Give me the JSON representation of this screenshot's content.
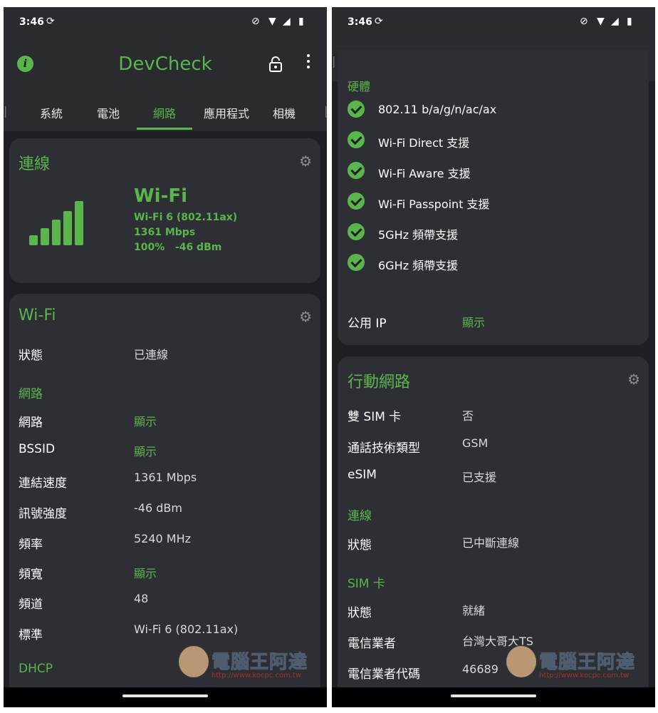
{
  "status": {
    "time": "3:46"
  },
  "app": {
    "title": "DevCheck"
  },
  "tabs": [
    "系統",
    "電池",
    "網路",
    "應用程式",
    "相機"
  ],
  "colors": {
    "accent": "#5ab54d",
    "background": "#1e1f22",
    "card": "#2e2f34"
  },
  "left": {
    "connection": {
      "title": "連線",
      "type": "Wi-Fi",
      "standard": "Wi-Fi 6 (802.11ax)",
      "speed": "1361 Mbps",
      "signal_percent": "100%",
      "signal_dbm": "-46 dBm",
      "signal_bars": 5
    },
    "wifi": {
      "title": "Wi-Fi",
      "status_label": "狀態",
      "status_value": "已連線",
      "section_network": "網路",
      "rows": [
        {
          "label": "網路",
          "value": "顯示",
          "link": true
        },
        {
          "label": "BSSID",
          "value": "顯示",
          "link": true
        },
        {
          "label": "連結速度",
          "value": "1361 Mbps",
          "link": false
        },
        {
          "label": "訊號強度",
          "value": "-46 dBm",
          "link": false
        },
        {
          "label": "頻率",
          "value": "5240 MHz",
          "link": false
        },
        {
          "label": "頻寬",
          "value": "顯示",
          "link": true
        },
        {
          "label": "頻道",
          "value": "48",
          "link": false
        },
        {
          "label": "標準",
          "value": "Wi-Fi 6 (802.11ax)",
          "link": false
        }
      ],
      "section_dhcp": "DHCP"
    }
  },
  "right": {
    "hardware": {
      "section": "硬體",
      "features": [
        "802.11 b/a/g/n/ac/ax",
        "Wi-Fi Direct 支援",
        "Wi-Fi Aware 支援",
        "Wi-Fi Passpoint 支援",
        "5GHz 頻帶支援",
        "6GHz 頻帶支援"
      ],
      "public_ip_label": "公用 IP",
      "public_ip_value": "顯示"
    },
    "mobile": {
      "title": "行動網路",
      "rows": [
        {
          "label": "雙 SIM 卡",
          "value": "否"
        },
        {
          "label": "通話技術類型",
          "value": "GSM"
        },
        {
          "label": "eSIM",
          "value": "已支援"
        }
      ],
      "section_connection": "連線",
      "conn_status_label": "狀態",
      "conn_status_value": "已中斷連線",
      "section_sim": "SIM 卡",
      "sim_rows": [
        {
          "label": "狀態",
          "value": "就緒"
        },
        {
          "label": "電信業者",
          "value": "台灣大哥大TS"
        },
        {
          "label": "電信業者代碼",
          "value": "46689"
        }
      ]
    }
  },
  "watermark": {
    "text": "電腦王阿達",
    "url": "http://www.kocpc.com.tw"
  }
}
